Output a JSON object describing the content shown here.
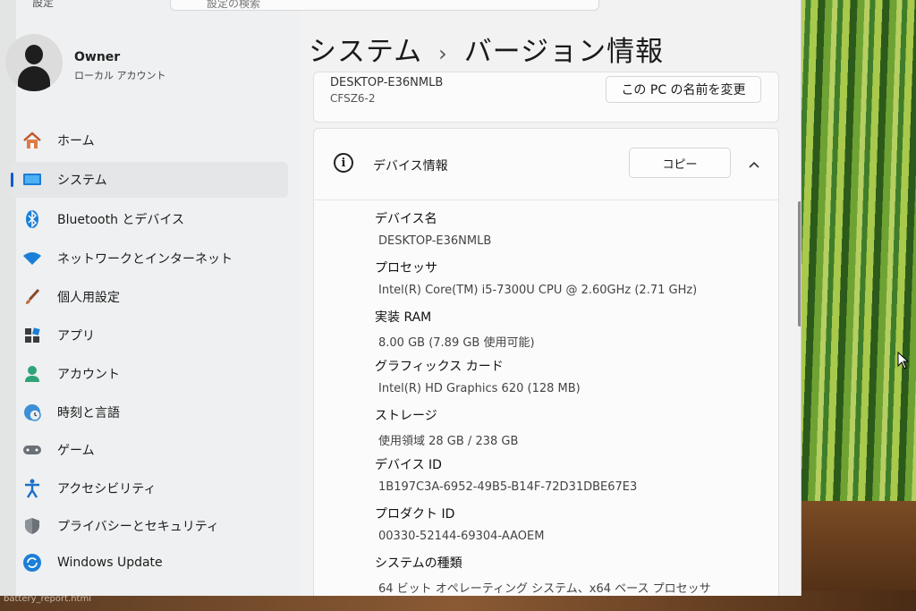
{
  "app": {
    "title": "設定"
  },
  "search": {
    "placeholder": "設定の検索"
  },
  "user": {
    "name": "Owner",
    "account_type": "ローカル アカウント"
  },
  "nav": {
    "items": [
      {
        "label": "ホーム",
        "icon": "home-icon"
      },
      {
        "label": "システム",
        "icon": "system-icon",
        "active": true
      },
      {
        "label": "Bluetooth とデバイス",
        "icon": "bluetooth-icon"
      },
      {
        "label": "ネットワークとインターネット",
        "icon": "wifi-icon"
      },
      {
        "label": "個人用設定",
        "icon": "brush-icon"
      },
      {
        "label": "アプリ",
        "icon": "apps-icon"
      },
      {
        "label": "アカウント",
        "icon": "account-icon"
      },
      {
        "label": "時刻と言語",
        "icon": "globe-clock-icon"
      },
      {
        "label": "ゲーム",
        "icon": "gamepad-icon"
      },
      {
        "label": "アクセシビリティ",
        "icon": "accessibility-icon"
      },
      {
        "label": "プライバシーとセキュリティ",
        "icon": "shield-icon"
      },
      {
        "label": "Windows Update",
        "icon": "update-icon"
      }
    ]
  },
  "header": {
    "parent": "システム",
    "separator": "›",
    "title": "バージョン情報"
  },
  "pc_card": {
    "device_name": "DESKTOP-E36NMLB",
    "model": "CFSZ6-2",
    "rename_label": "この PC の名前を変更"
  },
  "device_info": {
    "title": "デバイス情報",
    "copy_label": "コピー",
    "specs": [
      {
        "label": "デバイス名",
        "value": "DESKTOP-E36NMLB"
      },
      {
        "label": "プロセッサ",
        "value": "Intel(R) Core(TM) i5-7300U CPU @ 2.60GHz (2.71 GHz)"
      },
      {
        "label": "実装 RAM",
        "value": "8.00 GB (7.89 GB 使用可能)"
      },
      {
        "label": "グラフィックス カード",
        "value": "Intel(R) HD Graphics 620 (128 MB)"
      },
      {
        "label": "ストレージ",
        "value": "使用領域 28 GB / 238 GB"
      },
      {
        "label": "デバイス ID",
        "value": "1B197C3A-6952-49B5-B14F-72D31DBE67E3"
      },
      {
        "label": "プロダクト ID",
        "value": "00330-52144-69304-AAOEM"
      },
      {
        "label": "システムの種類",
        "value": "64 ビット オペレーティング システム、x64 ベース プロセッサ"
      }
    ]
  },
  "taskbar_hint": "battery_report.html",
  "colors": {
    "accent": "#0a5ccf",
    "window_bg": "#f2f2f2",
    "card_bg": "#fbfbfb"
  }
}
